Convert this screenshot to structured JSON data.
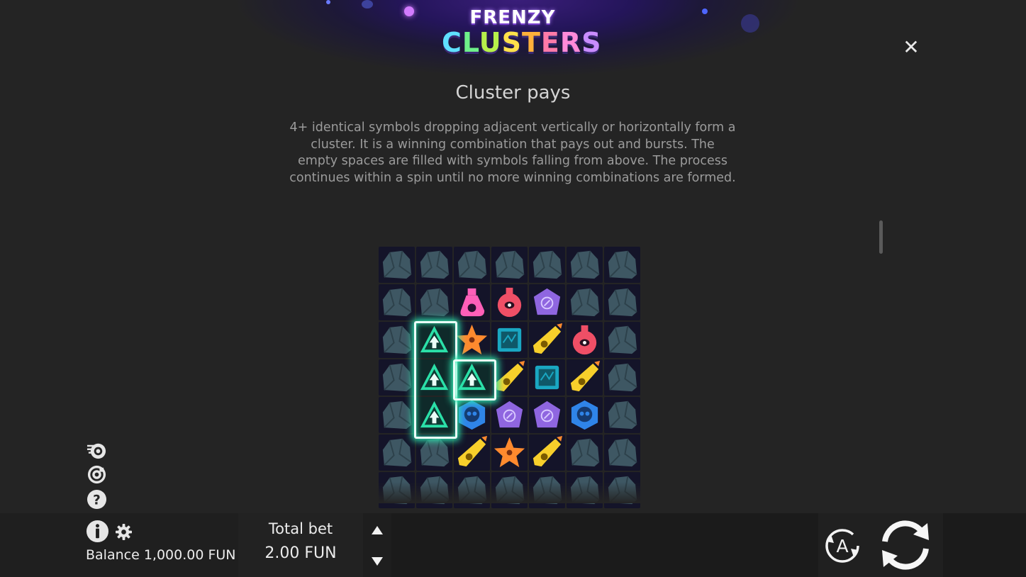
{
  "logo": {
    "line1": "FRENZY",
    "line2_letters": [
      "C",
      "L",
      "U",
      "S",
      "T",
      "E",
      "R",
      "S"
    ],
    "line2_colors": [
      "#5fe0ff",
      "#6ef08a",
      "#b6f04a",
      "#ffe04a",
      "#ffb03a",
      "#ff7aa8",
      "#ff8ad8",
      "#c98cff"
    ]
  },
  "page": {
    "title": "Cluster pays",
    "description": "4+ identical symbols dropping adjacent vertically or horizontally form a cluster. It is a winning combination that pays out and bursts. The empty spaces are filled with symbols falling from above. The process continues within a spin until no more winning combinations are formed."
  },
  "controls": {
    "close_icon": "close-icon",
    "side_icons": [
      "turbo-icon",
      "autoplay-settings-icon",
      "help-icon"
    ],
    "info_icon": "info-icon",
    "settings_icon": "gear-icon",
    "balance": "Balance 1,000.00 FUN",
    "total_bet_label": "Total bet",
    "total_bet_value": "2.00 FUN",
    "bet_up_icon": "triangle-up-icon",
    "bet_down_icon": "triangle-down-icon",
    "autoplay_icon": "autoplay-icon",
    "autoplay_letter": "A",
    "spin_icon": "spin-icon"
  },
  "grid": {
    "columns": 7,
    "rows": 7,
    "symbols": [
      [
        "rock",
        "rock",
        "rock",
        "rock",
        "rock",
        "rock",
        "rock"
      ],
      [
        "rock",
        "rock",
        "potion-pink",
        "potion-red",
        "gem-purple",
        "rock",
        "rock"
      ],
      [
        "rock",
        "triangle-green",
        "star-orange",
        "tablet-teal",
        "carrot-yellow",
        "potion-red",
        "rock"
      ],
      [
        "rock",
        "triangle-green",
        "triangle-green",
        "carrot-yellow",
        "tablet-teal",
        "carrot-yellow",
        "rock"
      ],
      [
        "rock",
        "triangle-green",
        "skull-blue",
        "gem-purple",
        "gem-purple",
        "skull-blue",
        "rock"
      ],
      [
        "rock",
        "rock",
        "carrot-yellow",
        "star-orange",
        "carrot-yellow",
        "rock",
        "rock"
      ],
      [
        "rock",
        "rock",
        "rock",
        "rock",
        "rock",
        "rock",
        "rock"
      ]
    ],
    "winning_cluster": "triangle-green",
    "colors": {
      "rock": "#3e5763",
      "potion-pink": "#ff5fb8",
      "potion-red": "#ef4f66",
      "gem-purple": "#8f66e0",
      "triangle-green": "#2be0a8",
      "star-orange": "#ff8a2e",
      "tablet-teal": "#1aa7c2",
      "carrot-yellow": "#f7cf2b",
      "skull-blue": "#2f84e8"
    }
  }
}
